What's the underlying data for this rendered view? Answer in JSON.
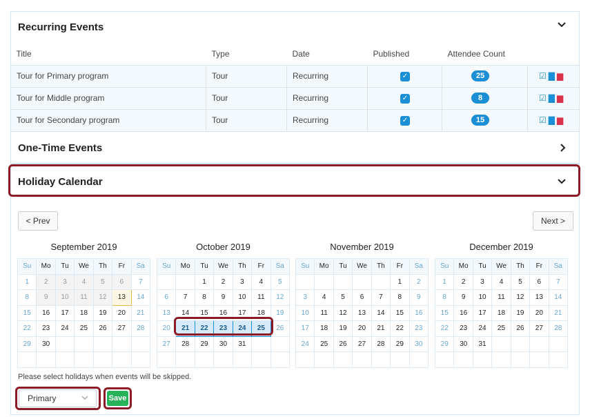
{
  "recurring": {
    "title": "Recurring Events",
    "columns": [
      "Title",
      "Type",
      "Date",
      "Published",
      "Attendee Count"
    ],
    "rows": [
      {
        "title": "Tour for Primary program",
        "type": "Tour",
        "date": "Recurring",
        "count": "25"
      },
      {
        "title": "Tour for Middle program",
        "type": "Tour",
        "date": "Recurring",
        "count": "8"
      },
      {
        "title": "Tour for Secondary program",
        "type": "Tour",
        "date": "Recurring",
        "count": "15"
      }
    ]
  },
  "onetime": {
    "title": "One-Time Events"
  },
  "holiday": {
    "title": "Holiday Calendar",
    "prev": "< Prev",
    "next": "Next >",
    "dow": [
      "Su",
      "Mo",
      "Tu",
      "We",
      "Th",
      "Fr",
      "Sa"
    ],
    "months": [
      {
        "name": "September 2019",
        "start": 0,
        "days": 30,
        "prevdays": 31
      },
      {
        "name": "October 2019",
        "start": 2,
        "days": 31,
        "prevdays": 30
      },
      {
        "name": "November 2019",
        "start": 5,
        "days": 30,
        "prevdays": 31
      },
      {
        "name": "December 2019",
        "start": 0,
        "days": 31,
        "prevdays": 30
      }
    ],
    "help": "Please select holidays when events will be skipped.",
    "select_value": "Primary",
    "save": "Save"
  },
  "colors": {
    "accent": "#1b8fd6",
    "highlight": "#8c1b26",
    "save": "#27b35a",
    "delete": "#d9334c"
  }
}
